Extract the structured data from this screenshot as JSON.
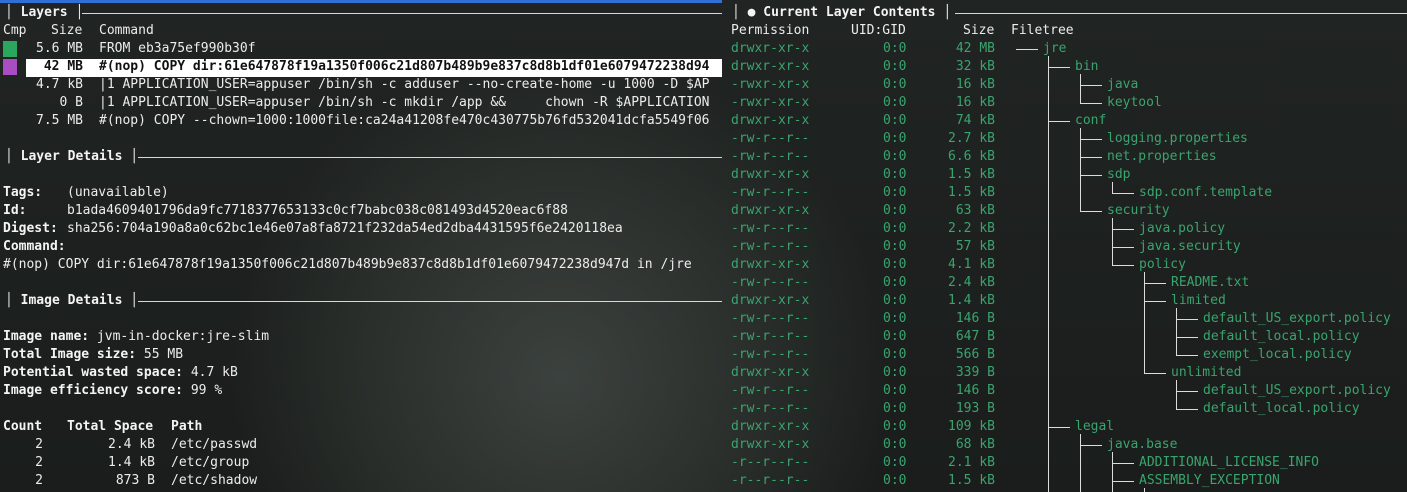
{
  "layers_panel": {
    "title": "Layers",
    "headers": {
      "cmp": "Cmp",
      "size": "Size",
      "command": "Command"
    },
    "rows": [
      {
        "size": "5.6 MB",
        "command": "FROM eb3a75ef990b30f",
        "marker_color": "#2aa65e"
      },
      {
        "size": "42 MB",
        "command": "#(nop) COPY dir:61e647878f19a1350f006c21d807b489b9e837c8d8b1df01e6079472238d94",
        "marker_color": "#a94ec2",
        "selected": true
      },
      {
        "size": "4.7 kB",
        "command": "|1 APPLICATION_USER=appuser /bin/sh -c adduser --no-create-home -u 1000 -D $AP"
      },
      {
        "size": "0 B",
        "command": "|1 APPLICATION_USER=appuser /bin/sh -c mkdir /app &&     chown -R $APPLICATION"
      },
      {
        "size": "7.5 MB",
        "command": "#(nop) COPY --chown=1000:1000file:ca24a41208fe470c430775b76fd532041dcfa5549f06"
      }
    ]
  },
  "layer_details": {
    "title": "Layer Details",
    "tags_label": "Tags:",
    "tags_value": "(unavailable)",
    "id_label": "Id:",
    "id_value": "b1ada4609401796da9fc7718377653133c0cf7babc038c081493d4520eac6f88",
    "digest_label": "Digest:",
    "digest_value": "sha256:704a190a8a0c62bc1e46e07a8fa8721f232da54ed2dba4431595f6e2420118ea",
    "command_label": "Command:",
    "command_value": "#(nop) COPY dir:61e647878f19a1350f006c21d807b489b9e837c8d8b1df01e6079472238d947d in /jre"
  },
  "image_details": {
    "title": "Image Details",
    "name_label": "Image name:",
    "name_value": "jvm-in-docker:jre-slim",
    "size_label": "Total Image size:",
    "size_value": "55 MB",
    "wasted_label": "Potential wasted space:",
    "wasted_value": "4.7 kB",
    "efficiency_label": "Image efficiency score:",
    "efficiency_value": "99 %",
    "table_headers": {
      "count": "Count",
      "total_space": "Total Space",
      "path": "Path"
    },
    "rows": [
      {
        "count": "2",
        "space": "2.4 kB",
        "path": "/etc/passwd"
      },
      {
        "count": "2",
        "space": "1.4 kB",
        "path": "/etc/group"
      },
      {
        "count": "2",
        "space": "873 B",
        "path": "/etc/shadow"
      }
    ]
  },
  "contents_panel": {
    "title": "● Current Layer Contents",
    "headers": {
      "permission": "Permission",
      "uidgid": "UID:GID",
      "size": "Size",
      "filetree": "Filetree"
    },
    "rows": [
      {
        "perm": "drwxr-xr-x",
        "uid": "0:0",
        "size": "42 MB",
        "name": "jre",
        "depth": 0
      },
      {
        "perm": "drwxr-xr-x",
        "uid": "0:0",
        "size": "32 kB",
        "name": "bin",
        "depth": 1
      },
      {
        "perm": "-rwxr-xr-x",
        "uid": "0:0",
        "size": "16 kB",
        "name": "java",
        "depth": 2
      },
      {
        "perm": "-rwxr-xr-x",
        "uid": "0:0",
        "size": "16 kB",
        "name": "keytool",
        "depth": 2
      },
      {
        "perm": "drwxr-xr-x",
        "uid": "0:0",
        "size": "74 kB",
        "name": "conf",
        "depth": 1
      },
      {
        "perm": "-rw-r--r--",
        "uid": "0:0",
        "size": "2.7 kB",
        "name": "logging.properties",
        "depth": 2
      },
      {
        "perm": "-rw-r--r--",
        "uid": "0:0",
        "size": "6.6 kB",
        "name": "net.properties",
        "depth": 2
      },
      {
        "perm": "drwxr-xr-x",
        "uid": "0:0",
        "size": "1.5 kB",
        "name": "sdp",
        "depth": 2
      },
      {
        "perm": "-rw-r--r--",
        "uid": "0:0",
        "size": "1.5 kB",
        "name": "sdp.conf.template",
        "depth": 3
      },
      {
        "perm": "drwxr-xr-x",
        "uid": "0:0",
        "size": "63 kB",
        "name": "security",
        "depth": 2
      },
      {
        "perm": "-rw-r--r--",
        "uid": "0:0",
        "size": "2.2 kB",
        "name": "java.policy",
        "depth": 3
      },
      {
        "perm": "-rw-r--r--",
        "uid": "0:0",
        "size": "57 kB",
        "name": "java.security",
        "depth": 3
      },
      {
        "perm": "drwxr-xr-x",
        "uid": "0:0",
        "size": "4.1 kB",
        "name": "policy",
        "depth": 3
      },
      {
        "perm": "-rw-r--r--",
        "uid": "0:0",
        "size": "2.4 kB",
        "name": "README.txt",
        "depth": 4
      },
      {
        "perm": "drwxr-xr-x",
        "uid": "0:0",
        "size": "1.4 kB",
        "name": "limited",
        "depth": 4
      },
      {
        "perm": "-rw-r--r--",
        "uid": "0:0",
        "size": "146 B",
        "name": "default_US_export.policy",
        "depth": 5
      },
      {
        "perm": "-rw-r--r--",
        "uid": "0:0",
        "size": "647 B",
        "name": "default_local.policy",
        "depth": 5
      },
      {
        "perm": "-rw-r--r--",
        "uid": "0:0",
        "size": "566 B",
        "name": "exempt_local.policy",
        "depth": 5
      },
      {
        "perm": "drwxr-xr-x",
        "uid": "0:0",
        "size": "339 B",
        "name": "unlimited",
        "depth": 4
      },
      {
        "perm": "-rw-r--r--",
        "uid": "0:0",
        "size": "146 B",
        "name": "default_US_export.policy",
        "depth": 5
      },
      {
        "perm": "-rw-r--r--",
        "uid": "0:0",
        "size": "193 B",
        "name": "default_local.policy",
        "depth": 5
      },
      {
        "perm": "drwxr-xr-x",
        "uid": "0:0",
        "size": "109 kB",
        "name": "legal",
        "depth": 1
      },
      {
        "perm": "drwxr-xr-x",
        "uid": "0:0",
        "size": "68 kB",
        "name": "java.base",
        "depth": 2
      },
      {
        "perm": "-r--r--r--",
        "uid": "0:0",
        "size": "2.1 kB",
        "name": "ADDITIONAL_LICENSE_INFO",
        "depth": 3
      },
      {
        "perm": "-r--r--r--",
        "uid": "0:0",
        "size": "1.5 kB",
        "name": "ASSEMBLY_EXCEPTION",
        "depth": 3
      }
    ]
  },
  "colors": {
    "tree_green": "#3aa46e",
    "selection_bg": "#ffffff",
    "accent_bar": "#2f6fd6"
  }
}
